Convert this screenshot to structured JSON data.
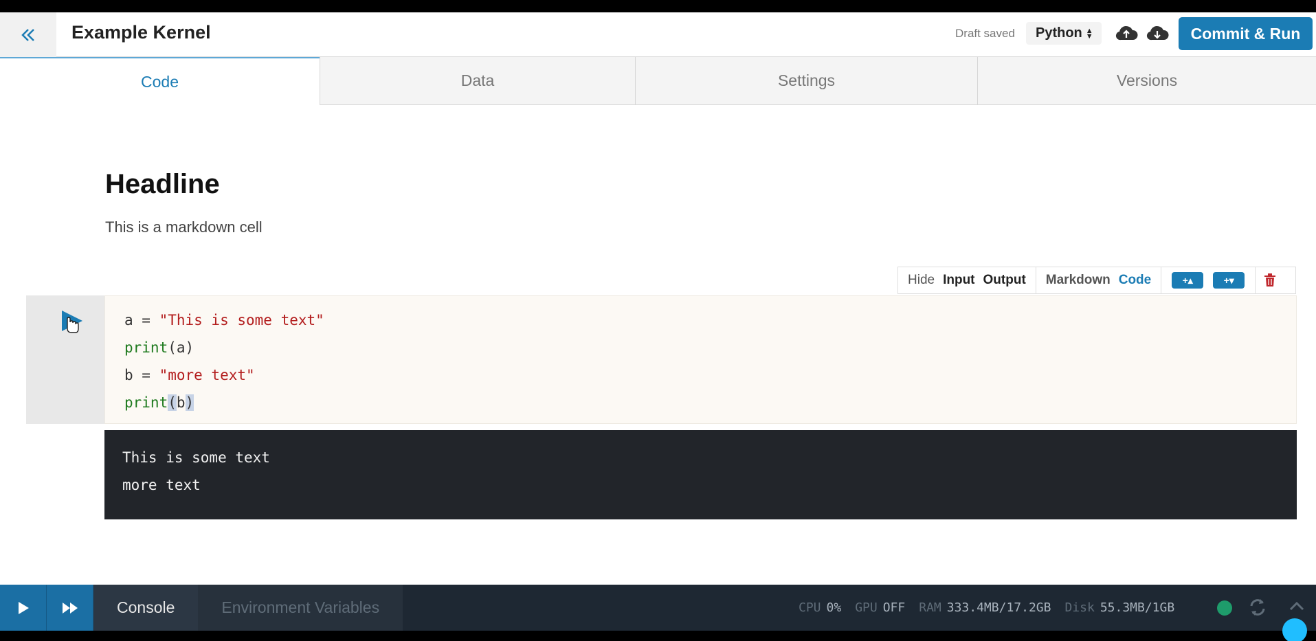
{
  "header": {
    "title": "Example Kernel",
    "draft_status": "Draft saved",
    "language": "Python",
    "commit_label": "Commit & Run"
  },
  "tabs": [
    {
      "label": "Code",
      "active": true
    },
    {
      "label": "Data",
      "active": false
    },
    {
      "label": "Settings",
      "active": false
    },
    {
      "label": "Versions",
      "active": false
    }
  ],
  "markdown_cell": {
    "headline": "Headline",
    "body": "This is a markdown cell"
  },
  "cell_toolbar": {
    "hide": "Hide",
    "input": "Input",
    "output": "Output",
    "markdown": "Markdown",
    "code": "Code",
    "add_above": "+▴",
    "add_below": "+▾"
  },
  "code_cell": {
    "lines": [
      {
        "a": "a = ",
        "b": "\"This is some text\""
      },
      {
        "a": "print",
        "b": "(a)"
      },
      {
        "a": "b = ",
        "b": "\"more text\""
      },
      {
        "a": "print",
        "b": "(",
        "c": "b",
        "d": ")"
      }
    ]
  },
  "output_cell": {
    "lines": [
      "This is some text",
      "more text"
    ]
  },
  "bottom_bar": {
    "console": "Console",
    "env_vars": "Environment Variables",
    "stats": [
      {
        "label": "CPU",
        "value": "0%"
      },
      {
        "label": "GPU",
        "value": "OFF"
      },
      {
        "label": "RAM",
        "value": "333.4MB/17.2GB"
      },
      {
        "label": "Disk",
        "value": "55.3MB/1GB"
      }
    ],
    "status_color": "#1e9c6b"
  },
  "colors": {
    "accent": "#1b7cb4",
    "string": "#b31d1d",
    "keyword": "#1e7a1e"
  }
}
